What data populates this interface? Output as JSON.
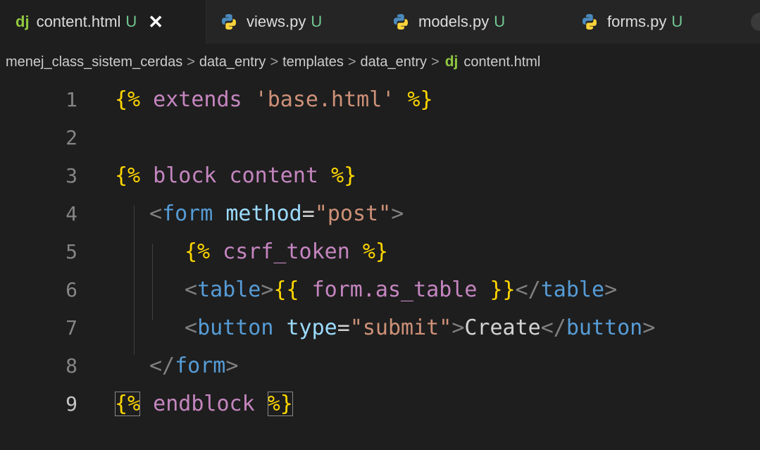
{
  "tabs": [
    {
      "icon": "dj",
      "label": "content.html",
      "status": "U",
      "close": "✕"
    },
    {
      "icon": "python",
      "label": "views.py",
      "status": "U"
    },
    {
      "icon": "python",
      "label": "models.py",
      "status": "U"
    },
    {
      "icon": "python",
      "label": "forms.py",
      "status": "U"
    }
  ],
  "breadcrumb": {
    "parts": [
      "menej_class_sistem_cerdas",
      "data_entry",
      "templates",
      "data_entry"
    ],
    "separator": ">",
    "file_icon": "dj",
    "file": "content.html"
  },
  "editor": {
    "line_numbers": [
      "1",
      "2",
      "3",
      "4",
      "5",
      "6",
      "7",
      "8",
      "9"
    ],
    "current_line": "9",
    "tokens": {
      "l1": [
        "{%",
        " extends ",
        "'base.html'",
        " %}"
      ],
      "l3": [
        "{%",
        " block content ",
        "%}"
      ],
      "l4": [
        "<",
        "form",
        " method",
        "=",
        "\"post\"",
        ">"
      ],
      "l5": [
        "{%",
        " csrf_token ",
        "%}"
      ],
      "l6": [
        "<",
        "table",
        ">",
        "{{",
        " form.as_table ",
        "}}",
        "</",
        "table",
        ">"
      ],
      "l7": [
        "<",
        "button",
        " type",
        "=",
        "\"submit\"",
        ">",
        "Create",
        "</",
        "button",
        ">"
      ],
      "l8": [
        "</",
        "form",
        ">"
      ],
      "l9": [
        "{%",
        " endblock ",
        "%}"
      ]
    }
  },
  "colors": {
    "background": "#1e1e1e",
    "tabbar": "#252526",
    "modified": "#73c991",
    "django": "#8fc740"
  }
}
